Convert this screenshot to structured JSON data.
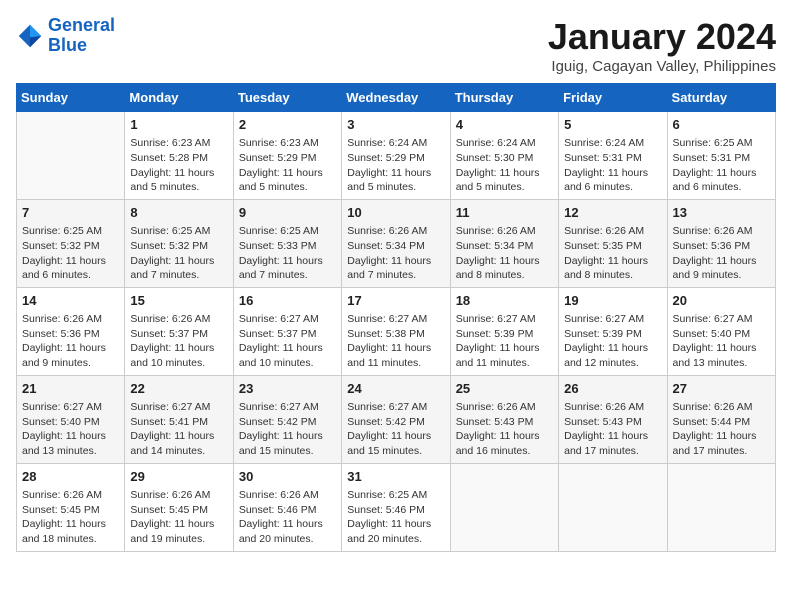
{
  "header": {
    "logo_line1": "General",
    "logo_line2": "Blue",
    "month_title": "January 2024",
    "subtitle": "Iguig, Cagayan Valley, Philippines"
  },
  "days_of_week": [
    "Sunday",
    "Monday",
    "Tuesday",
    "Wednesday",
    "Thursday",
    "Friday",
    "Saturday"
  ],
  "weeks": [
    [
      {
        "day": "",
        "info": ""
      },
      {
        "day": "1",
        "info": "Sunrise: 6:23 AM\nSunset: 5:28 PM\nDaylight: 11 hours\nand 5 minutes."
      },
      {
        "day": "2",
        "info": "Sunrise: 6:23 AM\nSunset: 5:29 PM\nDaylight: 11 hours\nand 5 minutes."
      },
      {
        "day": "3",
        "info": "Sunrise: 6:24 AM\nSunset: 5:29 PM\nDaylight: 11 hours\nand 5 minutes."
      },
      {
        "day": "4",
        "info": "Sunrise: 6:24 AM\nSunset: 5:30 PM\nDaylight: 11 hours\nand 5 minutes."
      },
      {
        "day": "5",
        "info": "Sunrise: 6:24 AM\nSunset: 5:31 PM\nDaylight: 11 hours\nand 6 minutes."
      },
      {
        "day": "6",
        "info": "Sunrise: 6:25 AM\nSunset: 5:31 PM\nDaylight: 11 hours\nand 6 minutes."
      }
    ],
    [
      {
        "day": "7",
        "info": "Sunrise: 6:25 AM\nSunset: 5:32 PM\nDaylight: 11 hours\nand 6 minutes."
      },
      {
        "day": "8",
        "info": "Sunrise: 6:25 AM\nSunset: 5:32 PM\nDaylight: 11 hours\nand 7 minutes."
      },
      {
        "day": "9",
        "info": "Sunrise: 6:25 AM\nSunset: 5:33 PM\nDaylight: 11 hours\nand 7 minutes."
      },
      {
        "day": "10",
        "info": "Sunrise: 6:26 AM\nSunset: 5:34 PM\nDaylight: 11 hours\nand 7 minutes."
      },
      {
        "day": "11",
        "info": "Sunrise: 6:26 AM\nSunset: 5:34 PM\nDaylight: 11 hours\nand 8 minutes."
      },
      {
        "day": "12",
        "info": "Sunrise: 6:26 AM\nSunset: 5:35 PM\nDaylight: 11 hours\nand 8 minutes."
      },
      {
        "day": "13",
        "info": "Sunrise: 6:26 AM\nSunset: 5:36 PM\nDaylight: 11 hours\nand 9 minutes."
      }
    ],
    [
      {
        "day": "14",
        "info": "Sunrise: 6:26 AM\nSunset: 5:36 PM\nDaylight: 11 hours\nand 9 minutes."
      },
      {
        "day": "15",
        "info": "Sunrise: 6:26 AM\nSunset: 5:37 PM\nDaylight: 11 hours\nand 10 minutes."
      },
      {
        "day": "16",
        "info": "Sunrise: 6:27 AM\nSunset: 5:37 PM\nDaylight: 11 hours\nand 10 minutes."
      },
      {
        "day": "17",
        "info": "Sunrise: 6:27 AM\nSunset: 5:38 PM\nDaylight: 11 hours\nand 11 minutes."
      },
      {
        "day": "18",
        "info": "Sunrise: 6:27 AM\nSunset: 5:39 PM\nDaylight: 11 hours\nand 11 minutes."
      },
      {
        "day": "19",
        "info": "Sunrise: 6:27 AM\nSunset: 5:39 PM\nDaylight: 11 hours\nand 12 minutes."
      },
      {
        "day": "20",
        "info": "Sunrise: 6:27 AM\nSunset: 5:40 PM\nDaylight: 11 hours\nand 13 minutes."
      }
    ],
    [
      {
        "day": "21",
        "info": "Sunrise: 6:27 AM\nSunset: 5:40 PM\nDaylight: 11 hours\nand 13 minutes."
      },
      {
        "day": "22",
        "info": "Sunrise: 6:27 AM\nSunset: 5:41 PM\nDaylight: 11 hours\nand 14 minutes."
      },
      {
        "day": "23",
        "info": "Sunrise: 6:27 AM\nSunset: 5:42 PM\nDaylight: 11 hours\nand 15 minutes."
      },
      {
        "day": "24",
        "info": "Sunrise: 6:27 AM\nSunset: 5:42 PM\nDaylight: 11 hours\nand 15 minutes."
      },
      {
        "day": "25",
        "info": "Sunrise: 6:26 AM\nSunset: 5:43 PM\nDaylight: 11 hours\nand 16 minutes."
      },
      {
        "day": "26",
        "info": "Sunrise: 6:26 AM\nSunset: 5:43 PM\nDaylight: 11 hours\nand 17 minutes."
      },
      {
        "day": "27",
        "info": "Sunrise: 6:26 AM\nSunset: 5:44 PM\nDaylight: 11 hours\nand 17 minutes."
      }
    ],
    [
      {
        "day": "28",
        "info": "Sunrise: 6:26 AM\nSunset: 5:45 PM\nDaylight: 11 hours\nand 18 minutes."
      },
      {
        "day": "29",
        "info": "Sunrise: 6:26 AM\nSunset: 5:45 PM\nDaylight: 11 hours\nand 19 minutes."
      },
      {
        "day": "30",
        "info": "Sunrise: 6:26 AM\nSunset: 5:46 PM\nDaylight: 11 hours\nand 20 minutes."
      },
      {
        "day": "31",
        "info": "Sunrise: 6:25 AM\nSunset: 5:46 PM\nDaylight: 11 hours\nand 20 minutes."
      },
      {
        "day": "",
        "info": ""
      },
      {
        "day": "",
        "info": ""
      },
      {
        "day": "",
        "info": ""
      }
    ]
  ]
}
